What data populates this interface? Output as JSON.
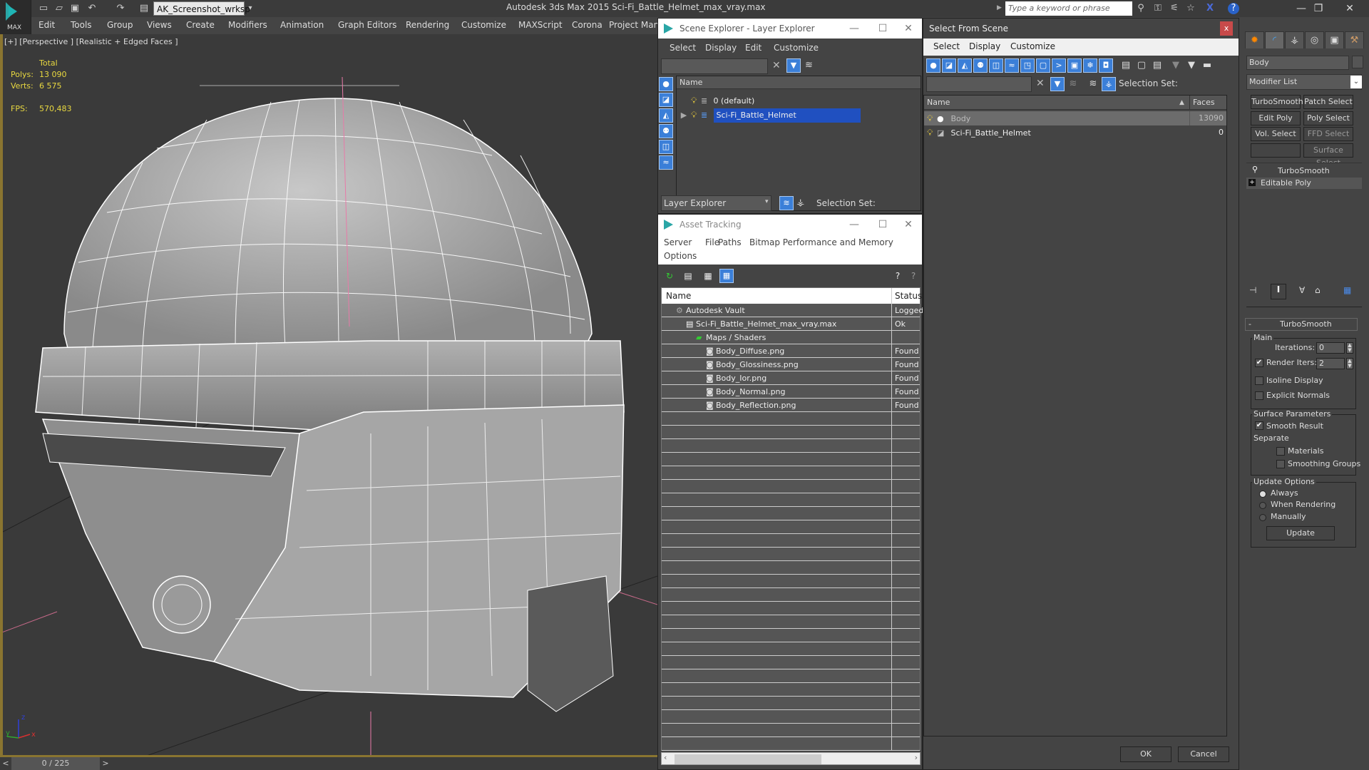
{
  "app": {
    "title": "Autodesk 3ds Max  2015    Sci-Fi_Battle_Helmet_max_vray.max",
    "logo_label": "MAX",
    "workspace": "AK_Screenshot_wrksp",
    "search_placeholder": "Type a keyword or phrase",
    "quick_access": [
      "new-icon",
      "open-icon",
      "save-icon",
      "undo-icon",
      "redo-icon",
      "project-icon"
    ],
    "info_icons": [
      "binoculars-icon",
      "key-icon",
      "satellite-icon",
      "star-icon",
      "x-icon",
      "help-icon"
    ],
    "window_controls": {
      "minimize": "—",
      "restore": "❐",
      "close": "✕"
    }
  },
  "menubar": [
    "Edit",
    "Tools",
    "Group",
    "Views",
    "Create",
    "Modifiers",
    "Animation",
    "Graph Editors",
    "Rendering",
    "Customize",
    "MAXScript",
    "Corona",
    "Project Man"
  ],
  "viewport": {
    "label": "[+] [Perspective ] [Realistic + Edged Faces ]",
    "stats": {
      "total_label": "Total",
      "polys_label": "Polys:",
      "polys": "13 090",
      "verts_label": "Verts:",
      "verts": "6 575",
      "fps_label": "FPS:",
      "fps": "570,483"
    },
    "axis": {
      "x": "x",
      "y": "y",
      "z": "z"
    }
  },
  "timeline": {
    "prev": "<",
    "value": "0 / 225",
    "next": ">"
  },
  "scene_explorer": {
    "title": "Scene Explorer - Layer Explorer",
    "menu": [
      "Select",
      "Display",
      "Edit",
      "Customize"
    ],
    "column_name": "Name",
    "layers": [
      {
        "name": "0 (default)",
        "selected": false
      },
      {
        "name": "Sci-Fi_Battle_Helmet",
        "selected": true
      }
    ],
    "footer_dropdown": "Layer Explorer",
    "selection_set_label": "Selection Set:"
  },
  "asset_tracking": {
    "title": "Asset Tracking",
    "menu": [
      "Server",
      "File",
      "Paths",
      "Bitmap Performance and Memory"
    ],
    "menu2": "Options",
    "columns": {
      "name": "Name",
      "status": "Status"
    },
    "rows": [
      {
        "name": "Autodesk Vault",
        "status": "Logged",
        "indent": 1,
        "icon": "vault-icon"
      },
      {
        "name": "Sci-Fi_Battle_Helmet_max_vray.max",
        "status": "Ok",
        "indent": 2,
        "icon": "max-file-icon"
      },
      {
        "name": "Maps / Shaders",
        "status": "",
        "indent": 3,
        "icon": "maps-icon"
      },
      {
        "name": "Body_Diffuse.png",
        "status": "Found",
        "indent": 4,
        "icon": "image-file-icon"
      },
      {
        "name": "Body_Glossiness.png",
        "status": "Found",
        "indent": 4,
        "icon": "image-file-icon"
      },
      {
        "name": "Body_Ior.png",
        "status": "Found",
        "indent": 4,
        "icon": "image-file-icon"
      },
      {
        "name": "Body_Normal.png",
        "status": "Found",
        "indent": 4,
        "icon": "image-file-icon"
      },
      {
        "name": "Body_Reflection.png",
        "status": "Found",
        "indent": 4,
        "icon": "image-file-icon"
      }
    ]
  },
  "select_from_scene": {
    "title": "Select From Scene",
    "close": "x",
    "menu": [
      "Select",
      "Display",
      "Customize"
    ],
    "selection_set_label": "Selection Set:",
    "columns": {
      "name": "Name",
      "faces": "Faces"
    },
    "rows": [
      {
        "name": "Body",
        "faces": "13090",
        "selected": true
      },
      {
        "name": "Sci-Fi_Battle_Helmet",
        "faces": "0",
        "selected": false
      }
    ],
    "ok": "OK",
    "cancel": "Cancel"
  },
  "command_panel": {
    "object_name": "Body",
    "modifier_list": "Modifier List",
    "buttons": [
      "TurboSmooth",
      "Patch Select",
      "Edit Poly",
      "Poly Select",
      "Vol. Select",
      "FFD Select",
      "",
      "Surface Select"
    ],
    "stack": [
      "TurboSmooth",
      "Editable Poly"
    ],
    "rollout_title": "TurboSmooth",
    "rollout_toggle": "-",
    "main": {
      "label": "Main",
      "iterations_label": "Iterations:",
      "iterations": "0",
      "render_iters_label": "Render Iters:",
      "render_iters": "2",
      "render_iters_checked": true,
      "isoline_label": "Isoline Display",
      "isoline_checked": false,
      "explicit_label": "Explicit Normals",
      "explicit_checked": false
    },
    "surface": {
      "label": "Surface Parameters",
      "smooth_label": "Smooth Result",
      "smooth_checked": true,
      "separate_label": "Separate",
      "materials_label": "Materials",
      "materials_checked": false,
      "smoothing_label": "Smoothing Groups",
      "smoothing_checked": false
    },
    "update": {
      "label": "Update Options",
      "options": [
        "Always",
        "When Rendering",
        "Manually"
      ],
      "selected": "Always",
      "button": "Update"
    }
  }
}
